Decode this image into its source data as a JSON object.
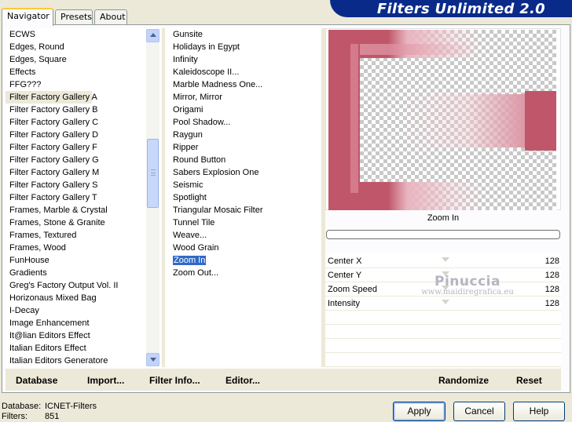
{
  "tabs": [
    {
      "label": "Navigator"
    },
    {
      "label": "Presets"
    },
    {
      "label": "About"
    }
  ],
  "app_title": "Filters Unlimited 2.0",
  "categories": [
    "ECWS",
    "Edges, Round",
    "Edges, Square",
    "Effects",
    "FFG???",
    "Filter Factory Gallery A",
    "Filter Factory Gallery B",
    "Filter Factory Gallery C",
    "Filter Factory Gallery D",
    "Filter Factory Gallery F",
    "Filter Factory Gallery G",
    "Filter Factory Gallery M",
    "Filter Factory Gallery S",
    "Filter Factory Gallery T",
    "Frames, Marble & Crystal",
    "Frames, Stone & Granite",
    "Frames, Textured",
    "Frames, Wood",
    "FunHouse",
    "Gradients",
    "Greg's Factory Output Vol. II",
    "Horizonaus Mixed Bag",
    "I-Decay",
    "Image Enhancement",
    "It@lian Editors Effect",
    "Italian Editors Effect",
    "Italian Editors Generatore"
  ],
  "selected_category": "Filter Factory Gallery A",
  "filters": [
    "Gunsite",
    "Holidays in Egypt",
    "Infinity",
    "Kaleidoscope II...",
    "Marble Madness One...",
    "Mirror, Mirror",
    "Origami",
    "Pool Shadow...",
    "Raygun",
    "Ripper",
    "Round Button",
    "Sabers Explosion One",
    "Seismic",
    "Spotlight",
    "Triangular Mosaic Filter",
    "Tunnel Tile",
    "Weave...",
    "Wood Grain",
    "Zoom In",
    "Zoom Out..."
  ],
  "selected_filter": "Zoom In",
  "preview": {
    "filter_name": "Zoom In"
  },
  "params": [
    {
      "label": "Center X",
      "value": "128"
    },
    {
      "label": "Center Y",
      "value": "128"
    },
    {
      "label": "Zoom Speed",
      "value": "128"
    },
    {
      "label": "Intensity",
      "value": "128"
    }
  ],
  "watermark": {
    "line1": "Pinuccia",
    "line2": "www.maidiregrafica.eu"
  },
  "bottom_buttons": {
    "database": "Database",
    "import": "Import...",
    "filter_info": "Filter Info...",
    "editor": "Editor...",
    "randomize": "Randomize",
    "reset": "Reset"
  },
  "footer": {
    "database_label": "Database:",
    "database_value": "ICNET-Filters",
    "filters_label": "Filters:",
    "filters_value": "851"
  },
  "dialog_buttons": {
    "apply": "Apply",
    "cancel": "Cancel",
    "help": "Help"
  },
  "colors": {
    "banner": "#0a2a8a",
    "selection": "#316ac5",
    "preview_pink": "#c0566a"
  }
}
